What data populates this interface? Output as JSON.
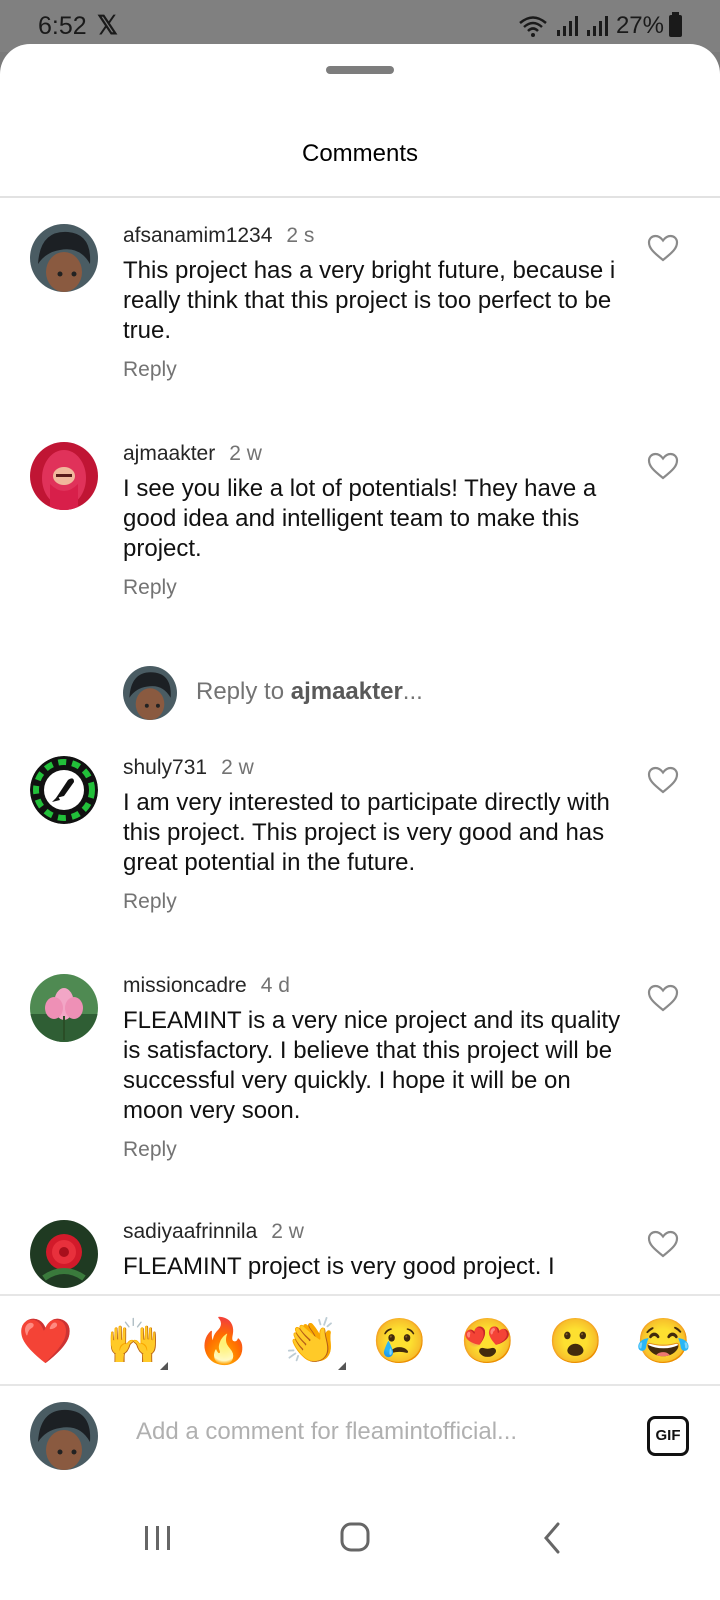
{
  "status_bar": {
    "time": "6:52",
    "x_logo": "𝕏",
    "battery": "27%",
    "icons": [
      "wifi-icon",
      "signal-icon",
      "signal-icon",
      "battery-icon"
    ]
  },
  "sheet": {
    "title": "Comments"
  },
  "comments": [
    {
      "username": "afsanamim1234",
      "time": "2 s",
      "text": "This project has a very bright future, because i really think that this project is too perfect to be true.",
      "reply_label": "Reply"
    },
    {
      "username": "ajmaakter",
      "time": "2 w",
      "text": "I see you like a lot of potentials! They have a good idea and intelligent team to make this project.",
      "reply_label": "Reply"
    },
    {
      "username": "shuly731",
      "time": "2 w",
      "text": "I am very interested to participate directly with this project. This project is very good and has great potential in the future.",
      "reply_label": "Reply"
    },
    {
      "username": "missioncadre",
      "time": "4 d",
      "text": "FLEAMINT is a very nice project and its quality is satisfactory. I believe that this project will be successful very quickly. I hope it will be on moon very soon.",
      "reply_label": "Reply"
    },
    {
      "username": "sadiyaafrinnila",
      "time": "2 w",
      "text": "FLEAMINT project is very good project. I",
      "reply_label": ""
    }
  ],
  "reply_prompt": {
    "prefix": "Reply to ",
    "username": "ajmaakter",
    "suffix": "..."
  },
  "emoji_bar": [
    "❤️",
    "🙌",
    "🔥",
    "👏",
    "😢",
    "😍",
    "😮",
    "😂"
  ],
  "add_comment": {
    "placeholder": "Add a comment for fleamintofficial...",
    "gif_label": "GIF"
  },
  "nav": {
    "icons": [
      "recent-apps-icon",
      "home-icon",
      "back-icon"
    ]
  }
}
